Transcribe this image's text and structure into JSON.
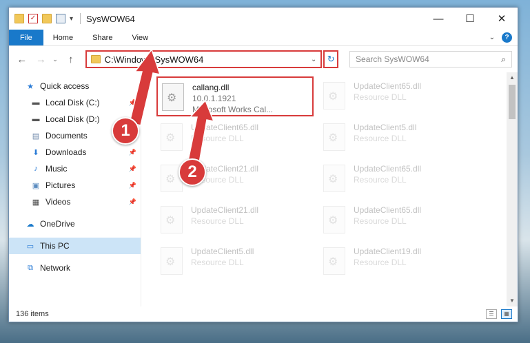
{
  "window": {
    "title": "SysWOW64",
    "controls": {
      "minimize": "—",
      "maximize": "☐",
      "close": "✕"
    }
  },
  "ribbon": {
    "tabs": [
      "File",
      "Home",
      "Share",
      "View"
    ],
    "help": "?"
  },
  "address_bar": {
    "path": "C:\\Windows\\SysWOW64",
    "refresh": "↻"
  },
  "search": {
    "placeholder": "Search SysWOW64",
    "icon": "⌕"
  },
  "sidebar": {
    "items": [
      {
        "label": "Quick access",
        "icon": "star-icon"
      },
      {
        "label": "Local Disk (C:)",
        "icon": "drive-icon"
      },
      {
        "label": "Local Disk (D:)",
        "icon": "drive-icon"
      },
      {
        "label": "Documents",
        "icon": "documents-icon"
      },
      {
        "label": "Downloads",
        "icon": "download-icon"
      },
      {
        "label": "Music",
        "icon": "music-icon"
      },
      {
        "label": "Pictures",
        "icon": "pictures-icon"
      },
      {
        "label": "Videos",
        "icon": "videos-icon"
      },
      {
        "label": "OneDrive",
        "icon": "cloud-icon"
      },
      {
        "label": "This PC",
        "icon": "computer-icon"
      },
      {
        "label": "Network",
        "icon": "network-icon"
      }
    ]
  },
  "files": [
    {
      "name": "callang.dll",
      "version": "10.0.1.1921",
      "description": "Microsoft Works Cal..."
    },
    {
      "name": "UpdateClient65.dll",
      "type": "Resource DLL"
    },
    {
      "name": "UpdateClient65.dll",
      "type": "Resource DLL"
    },
    {
      "name": "UpdateClient5.dll",
      "type": "Resource DLL"
    },
    {
      "name": "UpdateClient21.dll",
      "type": "Resource DLL"
    },
    {
      "name": "UpdateClient65.dll",
      "type": "Resource DLL"
    },
    {
      "name": "UpdateClient21.dll",
      "type": "Resource DLL"
    },
    {
      "name": "UpdateClient65.dll",
      "type": "Resource DLL"
    },
    {
      "name": "UpdateClient5.dll",
      "type": "Resource DLL"
    },
    {
      "name": "UpdateClient19.dll",
      "type": "Resource DLL"
    }
  ],
  "status": {
    "item_count": "136 items"
  },
  "annotations": {
    "step1": "1",
    "step2": "2",
    "color": "#d83b3b"
  }
}
